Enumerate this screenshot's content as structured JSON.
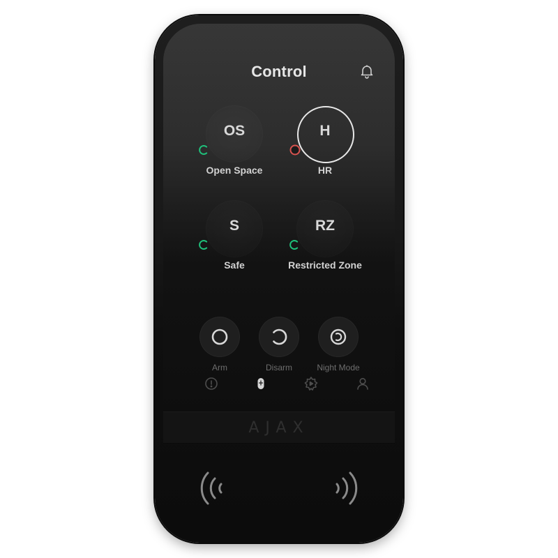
{
  "header": {
    "title": "Control"
  },
  "groups": [
    {
      "initials": "OS",
      "label": "Open Space",
      "status": "disarmed",
      "active": false
    },
    {
      "initials": "H",
      "label": "HR",
      "status": "alarm",
      "active": true
    },
    {
      "initials": "S",
      "label": "Safe",
      "status": "disarmed",
      "active": false
    },
    {
      "initials": "RZ",
      "label": "Restricted Zone",
      "status": "disarmed",
      "active": false
    }
  ],
  "actions": [
    {
      "label": "Arm",
      "icon": "arm-icon"
    },
    {
      "label": "Disarm",
      "icon": "disarm-icon"
    },
    {
      "label": "Night Mode",
      "icon": "night-mode-icon"
    }
  ],
  "nav": [
    {
      "icon": "alert-icon"
    },
    {
      "icon": "control-icon",
      "selected": true
    },
    {
      "icon": "scenarios-icon"
    },
    {
      "icon": "user-icon"
    }
  ],
  "brand": {
    "logo": "AJAX"
  },
  "colors": {
    "status_green": "#1fbf7a",
    "status_red": "#d9534f",
    "text_primary": "#e6e6e6",
    "text_muted": "#6e6e6e"
  }
}
